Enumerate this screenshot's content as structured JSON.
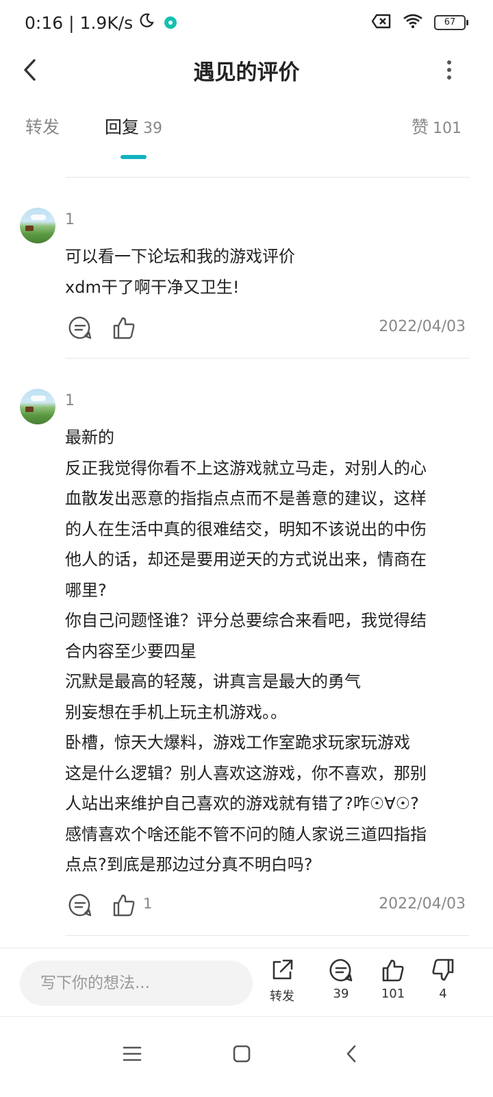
{
  "status_bar": {
    "time": "0:16",
    "network_speed": "1.9K/s",
    "battery": "67",
    "icons": [
      "moon-icon",
      "app-notification-dot",
      "sim-off-icon",
      "wifi-icon",
      "battery-icon"
    ]
  },
  "header": {
    "title": "遇见的评价",
    "back_icon": "chevron-left-icon",
    "more_icon": "vertical-dots-icon"
  },
  "tabs": {
    "forward": {
      "label": "转发"
    },
    "reply": {
      "label": "回复",
      "count": "39"
    },
    "like": {
      "label": "赞",
      "count": "101"
    },
    "active": "reply",
    "accent_color": "#14b2bf"
  },
  "comments": [
    {
      "username": "1",
      "lines": [
        "可以看一下论坛和我的游戏评价",
        "xdm干了啊干净又卫生!"
      ],
      "like_count": "",
      "date": "2022/04/03"
    },
    {
      "username": "1",
      "lines": [
        "最新的",
        "反正我觉得你看不上这游戏就立马走，对别人的心",
        "血散发出恶意的指指点点而不是善意的建议，这样",
        "的人在生活中真的很难结交，明知不该说出的中伤",
        "他人的话，却还是要用逆天的方式说出来，情商在",
        "哪里?",
        "你自己问题怪谁？评分总要综合来看吧，我觉得结",
        "合内容至少要四星",
        "沉默是最高的轻蔑，讲真言是最大的勇气",
        "别妄想在手机上玩主机游戏。。",
        "卧槽，惊天大爆料，游戏工作室跪求玩家玩游戏",
        "这是什么逻辑？别人喜欢这游戏，你不喜欢，那别",
        "人站出来维护自己喜欢的游戏就有错了?咋☉∀☉?",
        "感情喜欢个啥还能不管不问的随人家说三道四指指",
        "点点?到底是那边过分真不明白吗?"
      ],
      "like_count": "1",
      "date": "2022/04/03"
    }
  ],
  "bottom_bar": {
    "input_placeholder": "写下你的想法...",
    "forward_label": "转发",
    "comments_count": "39",
    "likes_count": "101",
    "dislikes_count": "4"
  },
  "nav_bar": {
    "icons": [
      "menu-icon",
      "home-icon",
      "back-icon"
    ]
  }
}
